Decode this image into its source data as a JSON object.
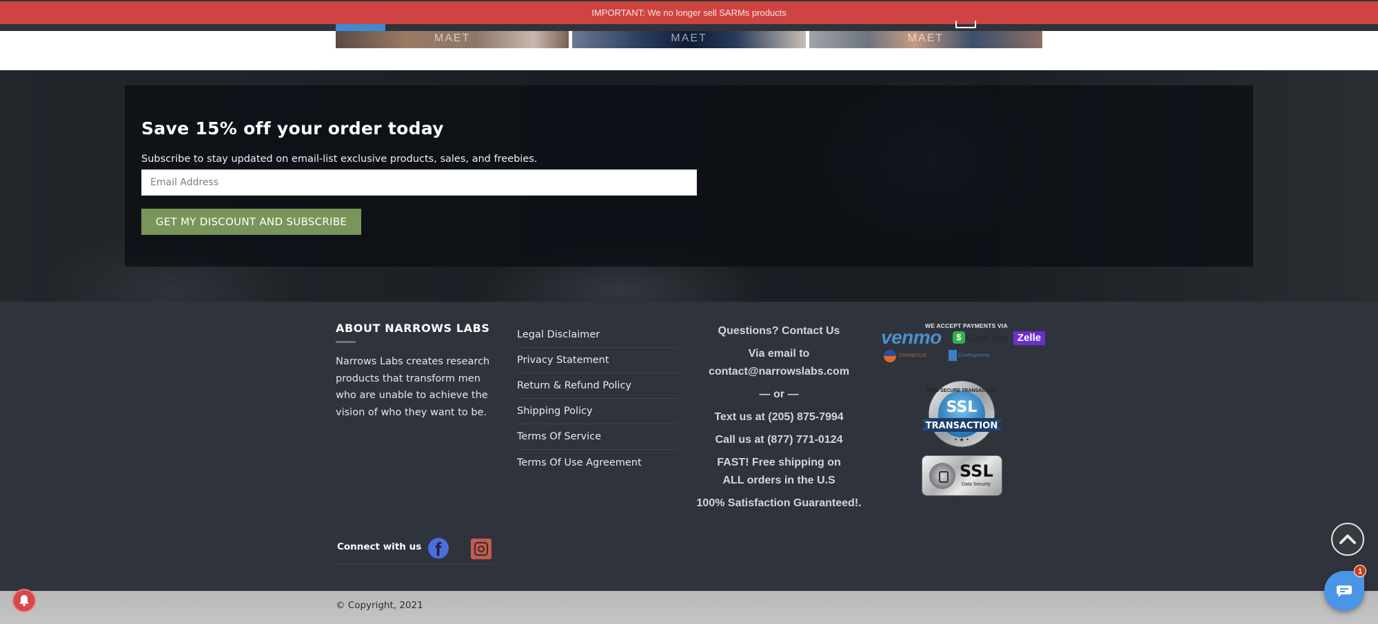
{
  "notice": {
    "text": "IMPORTANT: We no longer sell SARMs products",
    "color": "#cf4440"
  },
  "gallery": {
    "thumbnails": [
      {
        "caption": "MAET"
      },
      {
        "caption": "MAET"
      },
      {
        "caption": "MAET"
      }
    ]
  },
  "subscribe": {
    "title": "Save 15% off your order today",
    "subtitle": "Subscribe to stay updated on email-list exclusive products, sales, and freebies.",
    "email_placeholder": "Email Address",
    "email_value": "",
    "button_label": "GET MY DISCOUNT AND SUBSCRIBE",
    "button_color": "#7a9559"
  },
  "footer": {
    "about": {
      "title": "ABOUT NARROWS LABS",
      "text": "Narrows Labs creates research products that transform men who are unable to achieve the vision of who they want to be."
    },
    "links": [
      {
        "label": "Legal Disclaimer"
      },
      {
        "label": "Privacy Statement"
      },
      {
        "label": "Return & Refund Policy"
      },
      {
        "label": "Shipping Policy"
      },
      {
        "label": "Terms Of Service"
      },
      {
        "label": "Terms Of Use Agreement"
      }
    ],
    "contact": {
      "heading": "Questions? Contact Us",
      "email_intro": "Via email to",
      "email": "contact@narrowslabs.com",
      "separator": "— or —",
      "text_line": "Text us at (205) 875-7994",
      "call_line": "Call us at (877) 771-0124",
      "shipping_line": "FAST! Free shipping on ALL orders in the U.S",
      "guarantee_line": "100% Satisfaction Guaranteed!."
    },
    "payments": {
      "heading": "WE ACCEPT PAYMENTS VIA",
      "methods": [
        {
          "name": "venmo"
        },
        {
          "name": "Cash App",
          "icon": "$"
        },
        {
          "name": "Zelle"
        },
        {
          "name": "CONNEXUS"
        },
        {
          "name": "CoinPayments"
        }
      ]
    },
    "badges": {
      "ssl_transaction_top": "100% SECURE TRANSACTION",
      "ssl_transaction_main": "SSL",
      "ssl_transaction_ribbon": "TRANSACTION",
      "ssl_data_main": "SSL",
      "ssl_data_sub": "Data Security"
    },
    "social": {
      "label": "Connect with us",
      "networks": [
        {
          "name": "facebook",
          "glyph": "f",
          "color": "#4a6fe3"
        },
        {
          "name": "instagram",
          "color": "#c65a4e"
        }
      ]
    },
    "copyright": "© Copyright, 2021"
  },
  "widgets": {
    "chat_badge_count": "1"
  }
}
